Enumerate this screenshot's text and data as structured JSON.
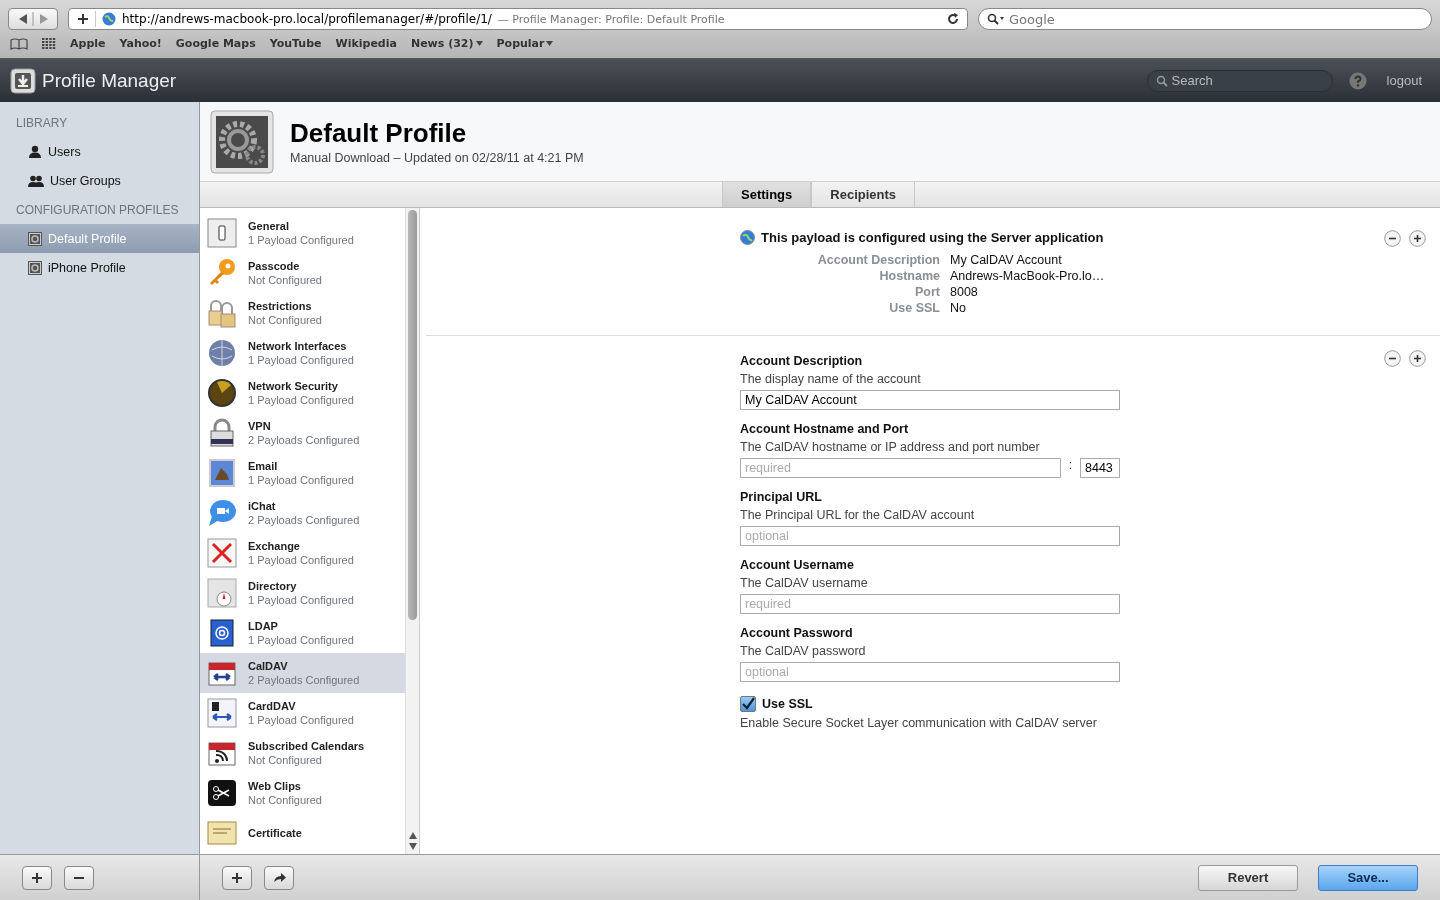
{
  "browser": {
    "url": "http://andrews-macbook-pro.local/profilemanager/#/profile/1/",
    "page_title": "— Profile Manager: Profile: Default Profile",
    "search_placeholder": "Google",
    "bookmarks": [
      {
        "label": "Apple",
        "menu": false
      },
      {
        "label": "Yahoo!",
        "menu": false
      },
      {
        "label": "Google Maps",
        "menu": false
      },
      {
        "label": "YouTube",
        "menu": false
      },
      {
        "label": "Wikipedia",
        "menu": false
      },
      {
        "label": "News (32)",
        "menu": true
      },
      {
        "label": "Popular",
        "menu": true
      }
    ]
  },
  "app": {
    "title": "Profile Manager",
    "search_placeholder": "Search",
    "logout": "logout"
  },
  "sidebar": {
    "sections": [
      {
        "heading": "LIBRARY",
        "items": [
          {
            "label": "Users",
            "selected": false
          },
          {
            "label": "User Groups",
            "selected": false
          }
        ]
      },
      {
        "heading": "CONFIGURATION PROFILES",
        "items": [
          {
            "label": "Default Profile",
            "selected": true
          },
          {
            "label": "iPhone Profile",
            "selected": false
          }
        ]
      }
    ]
  },
  "profile": {
    "title": "Default Profile",
    "subtitle": "Manual Download – Updated on 02/28/11 at 4:21 PM"
  },
  "tabs": [
    {
      "label": "Settings",
      "selected": true
    },
    {
      "label": "Recipients",
      "selected": false
    }
  ],
  "payloads": [
    {
      "name": "General",
      "status": "1 Payload Configured",
      "selected": false
    },
    {
      "name": "Passcode",
      "status": "Not Configured",
      "selected": false
    },
    {
      "name": "Restrictions",
      "status": "Not Configured",
      "selected": false
    },
    {
      "name": "Network Interfaces",
      "status": "1 Payload Configured",
      "selected": false
    },
    {
      "name": "Network Security",
      "status": "1 Payload Configured",
      "selected": false
    },
    {
      "name": "VPN",
      "status": "2 Payloads Configured",
      "selected": false
    },
    {
      "name": "Email",
      "status": "1 Payload Configured",
      "selected": false
    },
    {
      "name": "iChat",
      "status": "2 Payloads Configured",
      "selected": false
    },
    {
      "name": "Exchange",
      "status": "1 Payload Configured",
      "selected": false
    },
    {
      "name": "Directory",
      "status": "1 Payload Configured",
      "selected": false
    },
    {
      "name": "LDAP",
      "status": "1 Payload Configured",
      "selected": false
    },
    {
      "name": "CalDAV",
      "status": "2 Payloads Configured",
      "selected": true
    },
    {
      "name": "CardDAV",
      "status": "1 Payload Configured",
      "selected": false
    },
    {
      "name": "Subscribed Calendars",
      "status": "Not Configured",
      "selected": false
    },
    {
      "name": "Web Clips",
      "status": "Not Configured",
      "selected": false
    },
    {
      "name": "Certificate",
      "selected": false
    }
  ],
  "summary": {
    "title": "This payload is configured using the Server application",
    "fields": [
      {
        "label": "Account Description",
        "value": "My CalDAV Account"
      },
      {
        "label": "Hostname",
        "value": "Andrews-MacBook-Pro.lo…"
      },
      {
        "label": "Port",
        "value": "8008"
      },
      {
        "label": "Use SSL",
        "value": "No"
      }
    ]
  },
  "form": [
    {
      "kind": "text",
      "label": "Account Description",
      "description": "The display name of the account",
      "value": "My CalDAV Account"
    },
    {
      "kind": "hostport",
      "label": "Account Hostname and Port",
      "description": "The CalDAV hostname or IP address and port number",
      "placeholder": "required",
      "separator": ":",
      "port": "8443"
    },
    {
      "kind": "text",
      "label": "Principal URL",
      "description": "The Principal URL for the CalDAV account",
      "placeholder": "optional"
    },
    {
      "kind": "text",
      "label": "Account Username",
      "description": "The CalDAV username",
      "placeholder": "required"
    },
    {
      "kind": "text",
      "label": "Account Password",
      "description": "The CalDAV password",
      "placeholder": "optional"
    },
    {
      "kind": "checkbox",
      "label": "Use SSL",
      "description": "Enable Secure Socket Layer communication with CalDAV server",
      "checked": true
    }
  ],
  "buttons": {
    "revert": "Revert",
    "save": "Save..."
  }
}
